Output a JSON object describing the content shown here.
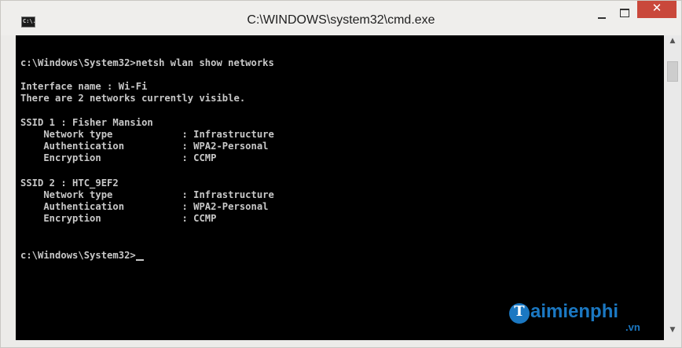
{
  "window": {
    "title": "C:\\WINDOWS\\system32\\cmd.exe",
    "icon": "cmd-icon",
    "icon_text": "C:\\.",
    "controls": {
      "minimize": "minimize-icon",
      "maximize": "maximize-icon",
      "close": "✕"
    }
  },
  "console": {
    "lines": [
      "c:\\Windows\\System32>netsh wlan show networks",
      "",
      "Interface name : Wi-Fi",
      "There are 2 networks currently visible.",
      "",
      "SSID 1 : Fisher Mansion",
      "    Network type            : Infrastructure",
      "    Authentication          : WPA2-Personal",
      "    Encryption              : CCMP",
      "",
      "SSID 2 : HTC_9EF2",
      "    Network type            : Infrastructure",
      "    Authentication          : WPA2-Personal",
      "    Encryption              : CCMP",
      "",
      "",
      "c:\\Windows\\System32>"
    ]
  },
  "scrollbar": {
    "up": "▲",
    "down": "▼"
  },
  "watermark": {
    "badge": "T",
    "text": "aimienphi",
    "suffix": ".vn"
  },
  "colors": {
    "console_bg": "#000000",
    "console_text": "#c8c8c8",
    "close": "#c9483b",
    "brand": "#1b78c2"
  }
}
